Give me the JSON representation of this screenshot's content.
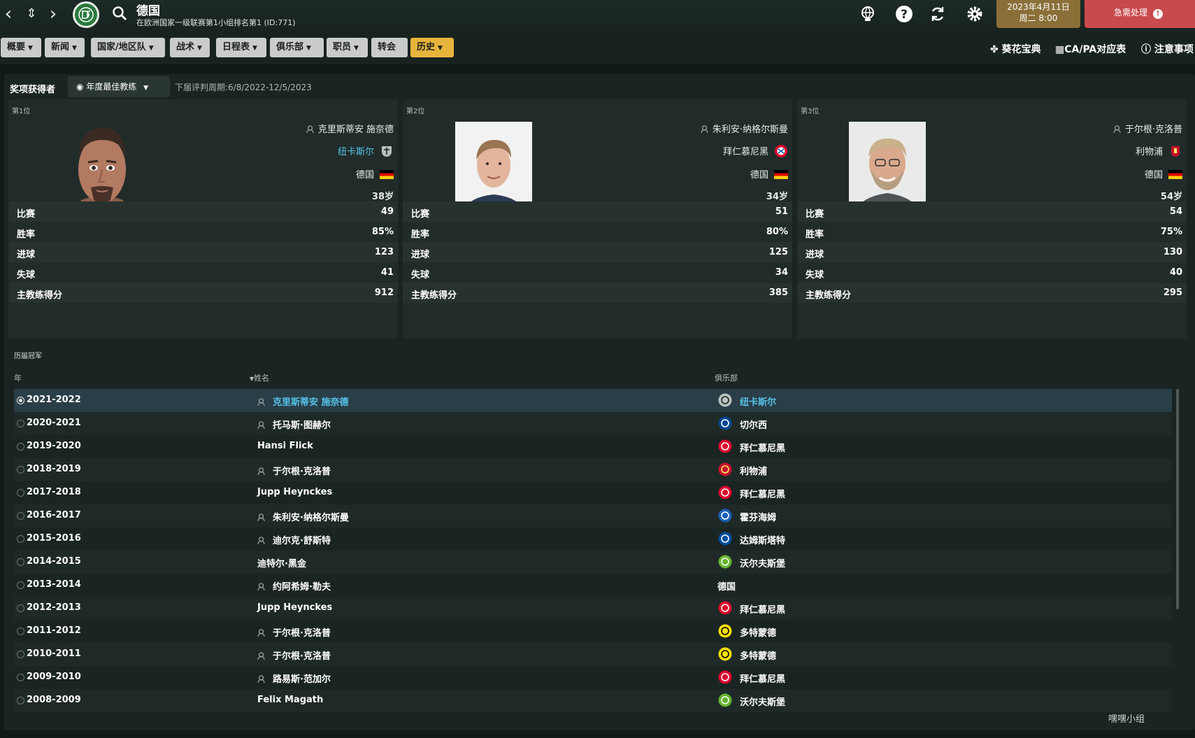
{
  "header": {
    "title": "德国",
    "subtitle": "在欧洲国家一级联赛第1小组排名第1 (ID:771)",
    "date_line1": "2023年4月11日",
    "date_line2": "周二 8:00",
    "urgent_label": "急需处理",
    "urgent_badge": "!"
  },
  "menu": {
    "items": [
      {
        "label": "概要"
      },
      {
        "label": "新闻"
      },
      {
        "label": "国家/地区队"
      },
      {
        "label": "战术"
      },
      {
        "label": "日程表"
      },
      {
        "label": "俱乐部"
      },
      {
        "label": "职员"
      },
      {
        "label": "转会"
      },
      {
        "label": "历史"
      }
    ],
    "right_links": [
      "葵花宝典",
      "CA/PA对应表",
      "注意事项"
    ]
  },
  "awards": {
    "label": "奖项获得者",
    "selected_award": "年度最佳教练",
    "period": "下届评判周期:6/8/2022-12/5/2023",
    "stat_labels": [
      "比赛",
      "胜率",
      "进球",
      "失球",
      "主教练得分"
    ],
    "winners": [
      {
        "rank": "第1位",
        "name": "克里斯蒂安 施奈德",
        "club": "纽卡斯尔",
        "nation": "德国",
        "age": "38岁",
        "stats": [
          "49",
          "85%",
          "123",
          "41",
          "912"
        ]
      },
      {
        "rank": "第2位",
        "name": "朱利安·纳格尔斯曼",
        "club": "拜仁慕尼黑",
        "nation": "德国",
        "age": "34岁",
        "stats": [
          "51",
          "80%",
          "125",
          "34",
          "385"
        ]
      },
      {
        "rank": "第3位",
        "name": "于尔根·克洛普",
        "club": "利物浦",
        "nation": "德国",
        "age": "54岁",
        "stats": [
          "54",
          "75%",
          "130",
          "40",
          "295"
        ]
      }
    ]
  },
  "history": {
    "title": "历届冠军",
    "col_year": "年",
    "col_name": "姓名",
    "col_club": "俱乐部",
    "rows": [
      {
        "year": "2021-2022",
        "name": "克里斯蒂安 施奈德",
        "club": "纽卡斯尔",
        "crest": "newcastle-crest-icon"
      },
      {
        "year": "2020-2021",
        "name": "托马斯·图赫尔",
        "club": "切尔西",
        "crest": "chelsea-crest-icon"
      },
      {
        "year": "2019-2020",
        "name": "Hansi Flick",
        "club": "拜仁慕尼黑",
        "crest": "bayern-crest-icon"
      },
      {
        "year": "2018-2019",
        "name": "于尔根·克洛普",
        "club": "利物浦",
        "crest": "liverpool-crest-icon"
      },
      {
        "year": "2017-2018",
        "name": "Jupp Heynckes",
        "club": "拜仁慕尼黑",
        "crest": "bayern-crest-icon"
      },
      {
        "year": "2016-2017",
        "name": "朱利安·纳格尔斯曼",
        "club": "霍芬海姆",
        "crest": "hoffenheim-crest-icon"
      },
      {
        "year": "2015-2016",
        "name": "迪尔克·舒斯特",
        "club": "达姆斯塔特",
        "crest": "darmstadt-crest-icon"
      },
      {
        "year": "2014-2015",
        "name": "迪特尔·黑金",
        "club": "沃尔夫斯堡",
        "crest": "wolfsburg-crest-icon"
      },
      {
        "year": "2013-2014",
        "name": "约阿希姆·勒夫",
        "club": "德国",
        "crest": ""
      },
      {
        "year": "2012-2013",
        "name": "Jupp Heynckes",
        "club": "拜仁慕尼黑",
        "crest": "bayern-crest-icon"
      },
      {
        "year": "2011-2012",
        "name": "于尔根·克洛普",
        "club": "多特蒙德",
        "crest": "dortmund-crest-icon"
      },
      {
        "year": "2010-2011",
        "name": "于尔根·克洛普",
        "club": "多特蒙德",
        "crest": "dortmund-crest-icon"
      },
      {
        "year": "2009-2010",
        "name": "路易斯·范加尔",
        "club": "拜仁慕尼黑",
        "crest": "bayern-crest-icon"
      },
      {
        "year": "2008-2009",
        "name": "Felix Magath",
        "club": "沃尔夫斯堡",
        "crest": "wolfsburg-crest-icon"
      }
    ]
  },
  "watermark": "嘿嘿小组",
  "colors": {
    "accent_gold": "#e7b43b",
    "link_blue": "#56c3e8",
    "urgent_red": "#c94a4c"
  }
}
